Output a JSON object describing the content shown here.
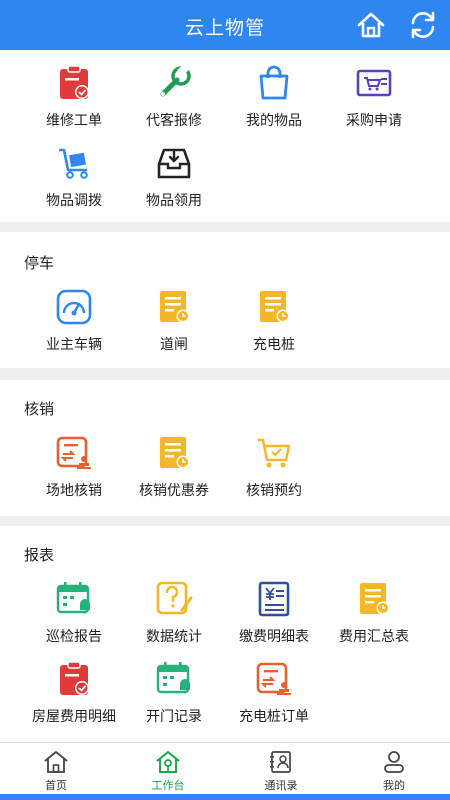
{
  "header": {
    "title": "云上物管"
  },
  "sections": {
    "main": {
      "items": [
        {
          "label": "维修工单"
        },
        {
          "label": "代客报修"
        },
        {
          "label": "我的物品"
        },
        {
          "label": "采购申请"
        },
        {
          "label": "物品调拨"
        },
        {
          "label": "物品领用"
        }
      ]
    },
    "parking": {
      "title": "停车",
      "items": [
        {
          "label": "业主车辆"
        },
        {
          "label": "道闸"
        },
        {
          "label": "充电桩"
        }
      ]
    },
    "verify": {
      "title": "核销",
      "items": [
        {
          "label": "场地核销"
        },
        {
          "label": "核销优惠券"
        },
        {
          "label": "核销预约"
        }
      ]
    },
    "report": {
      "title": "报表",
      "items": [
        {
          "label": "巡检报告"
        },
        {
          "label": "数据统计"
        },
        {
          "label": "缴费明细表"
        },
        {
          "label": "费用汇总表"
        },
        {
          "label": "房屋费用明细"
        },
        {
          "label": "开门记录"
        },
        {
          "label": "充电桩订单"
        }
      ]
    }
  },
  "tabbar": {
    "tabs": [
      {
        "label": "首页"
      },
      {
        "label": "工作台"
      },
      {
        "label": "通讯录"
      },
      {
        "label": "我的"
      }
    ]
  },
  "colors": {
    "primary": "#2f86f0",
    "red": "#e03a3a",
    "green": "#1f9d55",
    "orange": "#f5b72a",
    "tealgreen": "#26b07a",
    "purple": "#5a3fc2",
    "darkorange": "#e8612c"
  }
}
